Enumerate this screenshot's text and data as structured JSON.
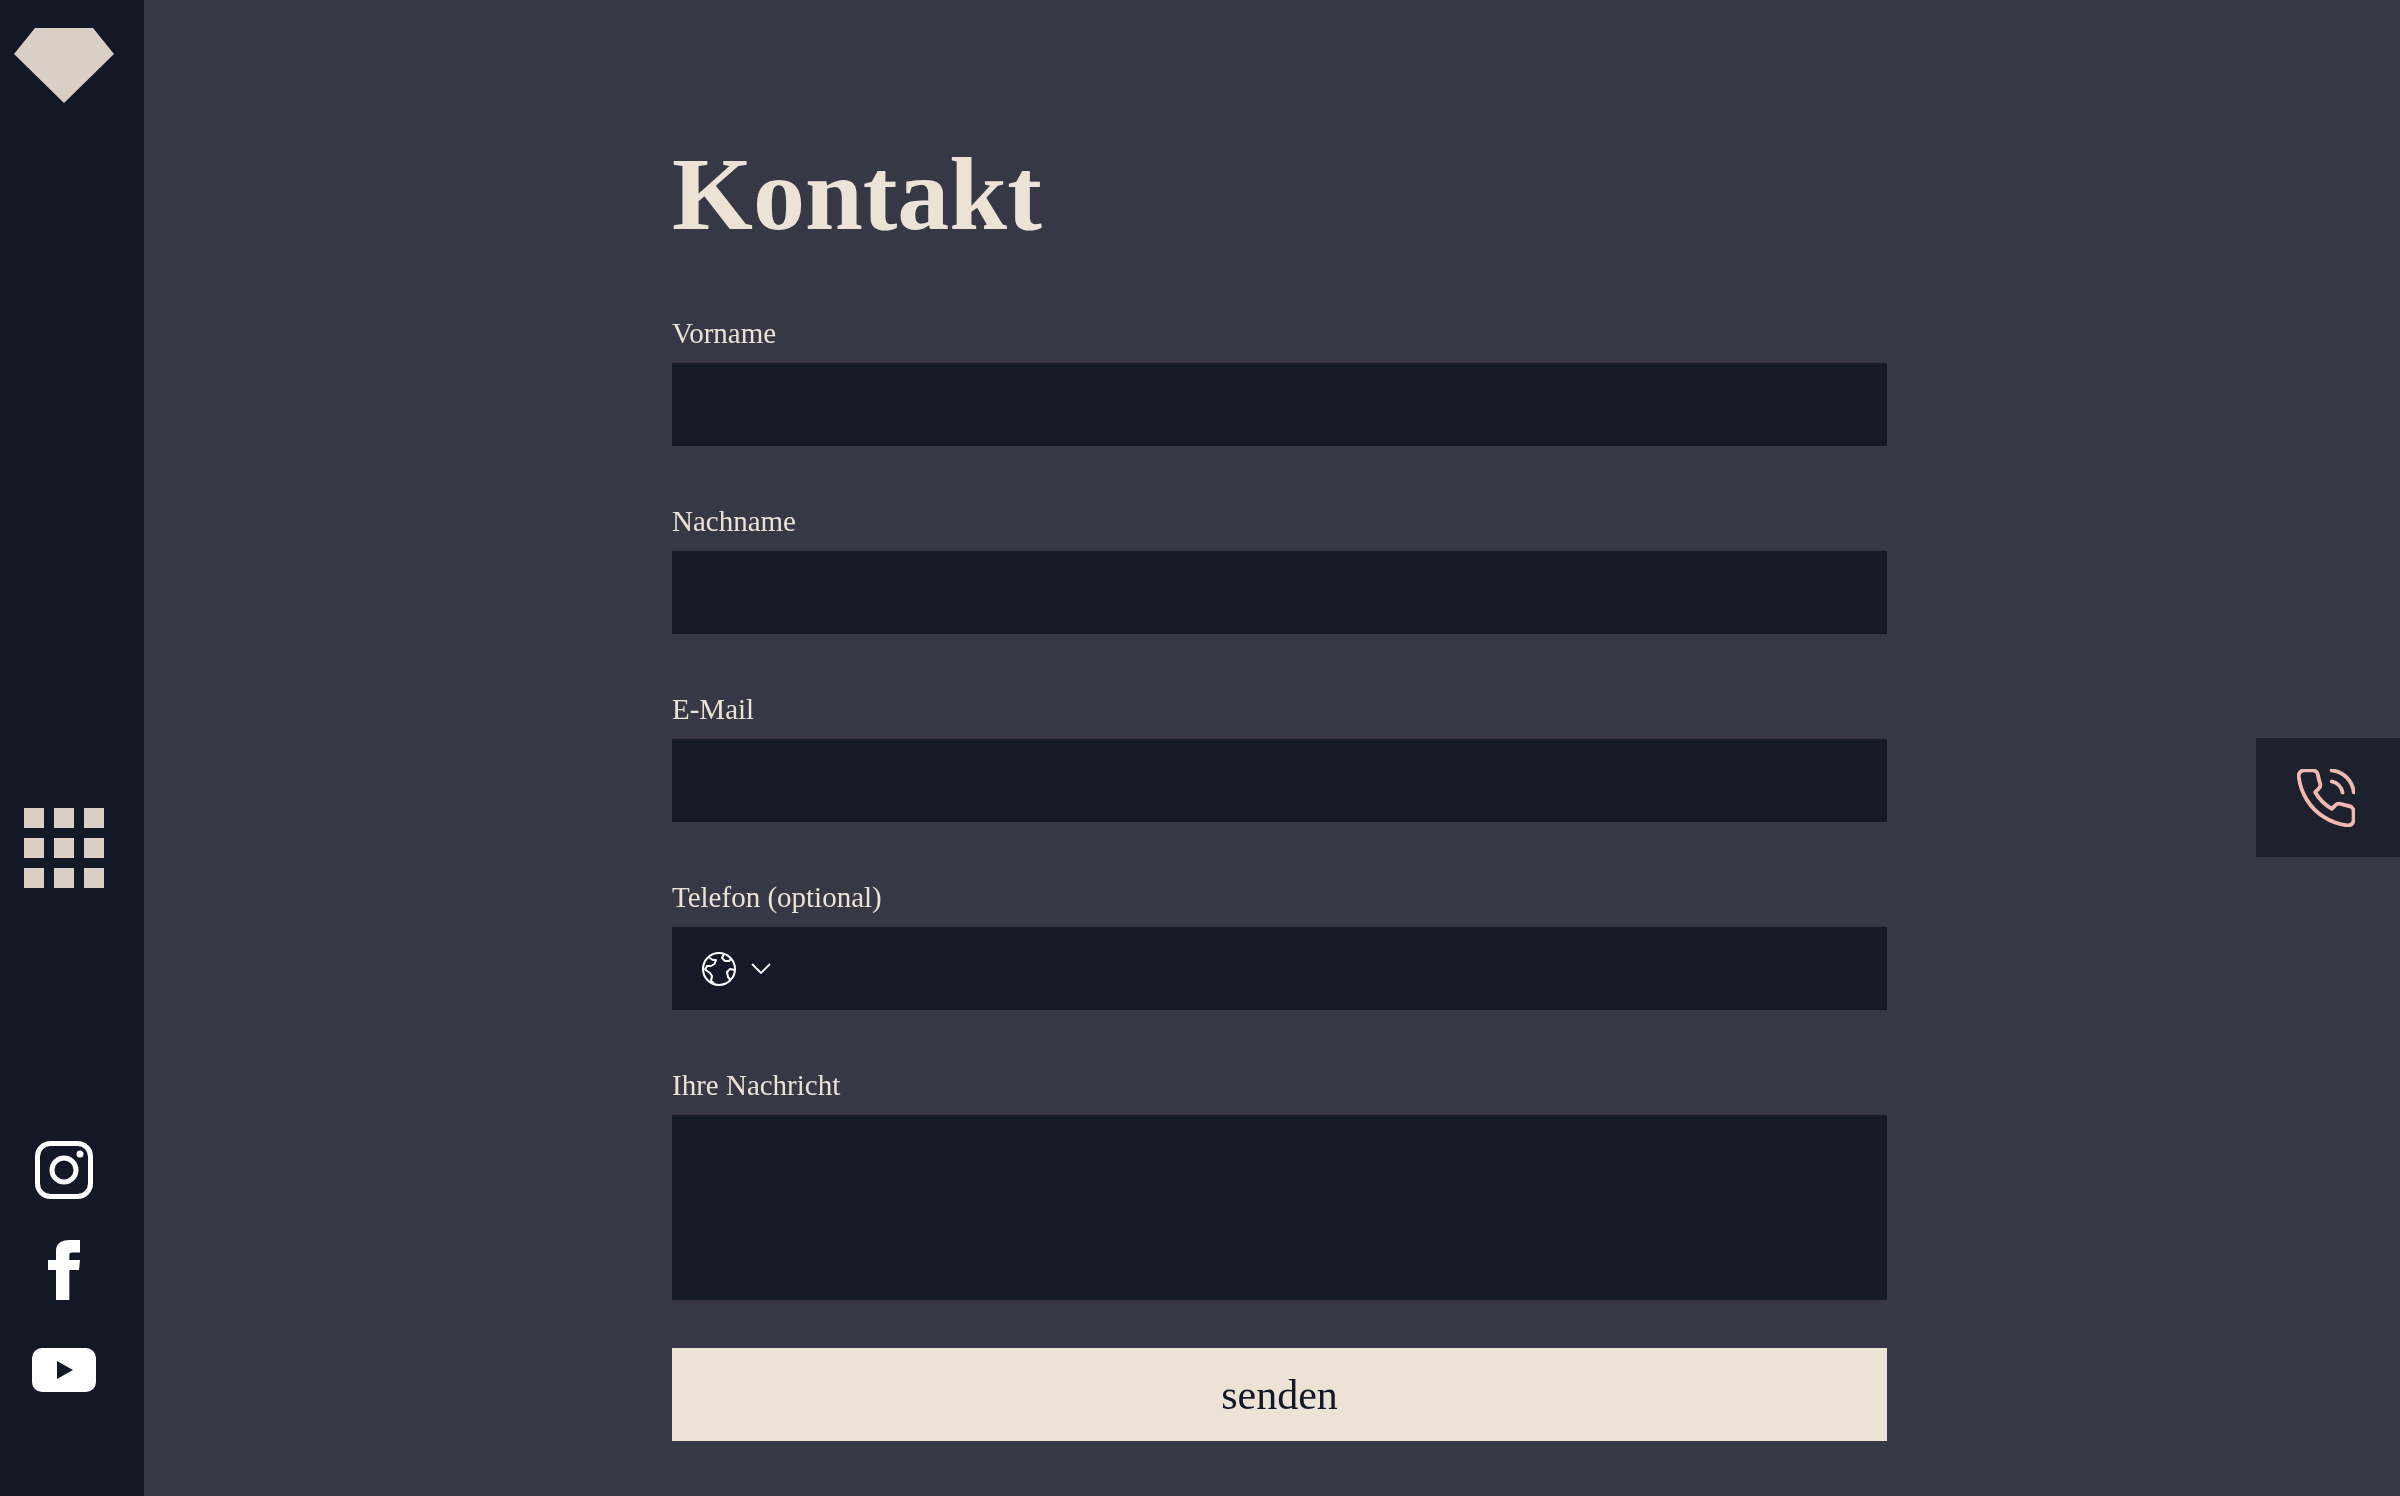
{
  "page": {
    "title": "Kontakt"
  },
  "form": {
    "fields": [
      {
        "label": "Vorname",
        "kind": "text"
      },
      {
        "label": "Nachname",
        "kind": "text"
      },
      {
        "label": "E-Mail",
        "kind": "email"
      },
      {
        "label": "Telefon (optional)",
        "kind": "phone"
      },
      {
        "label": "Ihre Nachricht",
        "kind": "textarea"
      }
    ],
    "submit_button": "senden"
  }
}
